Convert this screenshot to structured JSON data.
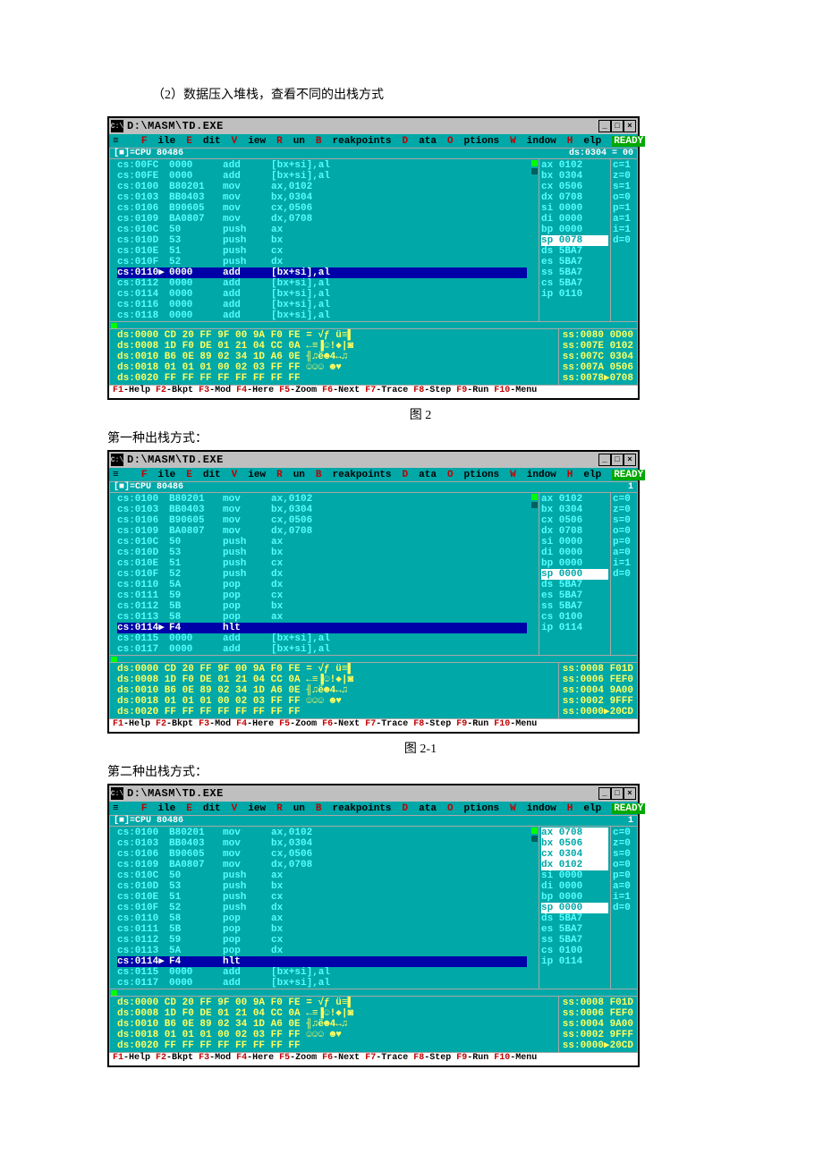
{
  "caption_top": "（2）数据压入堆栈，查看不同的出栈方式",
  "caption_fig2": "图 2",
  "caption_fig21": "图 2-1",
  "subcap1": "第一种出栈方式：",
  "subcap2": "第二种出栈方式：",
  "titlebar_title": "D:\\MASM\\TD.EXE",
  "titlebar_icon": "C:\\",
  "menu": {
    "file": "File",
    "edit": "Edit",
    "view": "View",
    "run": "Run",
    "breakpoints": "Breakpoints",
    "data": "Data",
    "options": "Options",
    "window": "Window",
    "help": "Help",
    "ready": "READY",
    "marker": "≡"
  },
  "btn_min": "_",
  "btn_max": "□",
  "btn_close": "×",
  "wintitle_left": "[■]=CPU 80486",
  "d1": {
    "wintitle_right": "ds:0304 = 00",
    "code": [
      {
        "a": "cs:00FC",
        "b": "0000",
        "m": "add",
        "o": "[bx+si],al"
      },
      {
        "a": "cs:00FE",
        "b": "0000",
        "m": "add",
        "o": "[bx+si],al"
      },
      {
        "a": "cs:0100",
        "b": "B80201",
        "m": "mov",
        "o": "ax,0102"
      },
      {
        "a": "cs:0103",
        "b": "BB0403",
        "m": "mov",
        "o": "bx,0304"
      },
      {
        "a": "cs:0106",
        "b": "B90605",
        "m": "mov",
        "o": "cx,0506"
      },
      {
        "a": "cs:0109",
        "b": "BA0807",
        "m": "mov",
        "o": "dx,0708"
      },
      {
        "a": "cs:010C",
        "b": "50",
        "m": "push",
        "o": "ax"
      },
      {
        "a": "cs:010D",
        "b": "53",
        "m": "push",
        "o": "bx"
      },
      {
        "a": "cs:010E",
        "b": "51",
        "m": "push",
        "o": "cx"
      },
      {
        "a": "cs:010F",
        "b": "52",
        "m": "push",
        "o": "dx"
      },
      {
        "a": "cs:0110▶",
        "b": "0000",
        "m": "add",
        "o": "[bx+si],al",
        "cur": true
      },
      {
        "a": "cs:0112",
        "b": "0000",
        "m": "add",
        "o": "[bx+si],al"
      },
      {
        "a": "cs:0114",
        "b": "0000",
        "m": "add",
        "o": "[bx+si],al"
      },
      {
        "a": "cs:0116",
        "b": "0000",
        "m": "add",
        "o": "[bx+si],al"
      },
      {
        "a": "cs:0118",
        "b": "0000",
        "m": "add",
        "o": "[bx+si],al"
      }
    ],
    "regs": [
      {
        "n": "ax",
        "v": "0102"
      },
      {
        "n": "bx",
        "v": "0304"
      },
      {
        "n": "cx",
        "v": "0506"
      },
      {
        "n": "dx",
        "v": "0708"
      },
      {
        "n": "si",
        "v": "0000"
      },
      {
        "n": "di",
        "v": "0000"
      },
      {
        "n": "bp",
        "v": "0000"
      },
      {
        "n": "sp",
        "v": "0078",
        "hl": true
      },
      {
        "n": "ds",
        "v": "5BA7"
      },
      {
        "n": "es",
        "v": "5BA7"
      },
      {
        "n": "ss",
        "v": "5BA7"
      },
      {
        "n": "cs",
        "v": "5BA7"
      },
      {
        "n": "ip",
        "v": "0110"
      }
    ],
    "flags": [
      "c=1",
      "z=0",
      "s=1",
      "o=0",
      "p=1",
      "a=1",
      "i=1",
      "d=0"
    ],
    "dump": [
      "ds:0000 CD 20 FF 9F 00 9A F0 FE = √ƒ ü≡▌",
      "ds:0008 1D F0 DE 01 21 04 CC 0A ←≡▐☺!◆|◙",
      "ds:0010 B6 0E 89 02 34 1D A6 0E ╢♫ë☻4↔♫",
      "ds:0018 01 01 01 00 02 03 FF FF ☺☺☺ ☻♥  ",
      "ds:0020 FF FF FF FF FF FF FF FF         "
    ],
    "stack": [
      "ss:0080 0D00",
      "ss:007E 0102",
      "ss:007C 0304",
      "ss:007A 0506",
      "ss:0078▶0708"
    ]
  },
  "d2": {
    "code": [
      {
        "a": "cs:0100",
        "b": "B80201",
        "m": "mov",
        "o": "ax,0102"
      },
      {
        "a": "cs:0103",
        "b": "BB0403",
        "m": "mov",
        "o": "bx,0304"
      },
      {
        "a": "cs:0106",
        "b": "B90605",
        "m": "mov",
        "o": "cx,0506"
      },
      {
        "a": "cs:0109",
        "b": "BA0807",
        "m": "mov",
        "o": "dx,0708"
      },
      {
        "a": "cs:010C",
        "b": "50",
        "m": "push",
        "o": "ax"
      },
      {
        "a": "cs:010D",
        "b": "53",
        "m": "push",
        "o": "bx"
      },
      {
        "a": "cs:010E",
        "b": "51",
        "m": "push",
        "o": "cx"
      },
      {
        "a": "cs:010F",
        "b": "52",
        "m": "push",
        "o": "dx"
      },
      {
        "a": "cs:0110",
        "b": "5A",
        "m": "pop",
        "o": "dx"
      },
      {
        "a": "cs:0111",
        "b": "59",
        "m": "pop",
        "o": "cx"
      },
      {
        "a": "cs:0112",
        "b": "5B",
        "m": "pop",
        "o": "bx"
      },
      {
        "a": "cs:0113",
        "b": "58",
        "m": "pop",
        "o": "ax"
      },
      {
        "a": "cs:0114▶",
        "b": "F4",
        "m": "hlt",
        "o": "",
        "cur": true
      },
      {
        "a": "cs:0115",
        "b": "0000",
        "m": "add",
        "o": "[bx+si],al"
      },
      {
        "a": "cs:0117",
        "b": "0000",
        "m": "add",
        "o": "[bx+si],al"
      }
    ],
    "regs": [
      {
        "n": "ax",
        "v": "0102"
      },
      {
        "n": "bx",
        "v": "0304"
      },
      {
        "n": "cx",
        "v": "0506"
      },
      {
        "n": "dx",
        "v": "0708"
      },
      {
        "n": "si",
        "v": "0000"
      },
      {
        "n": "di",
        "v": "0000"
      },
      {
        "n": "bp",
        "v": "0000"
      },
      {
        "n": "sp",
        "v": "0000",
        "hl": true
      },
      {
        "n": "ds",
        "v": "5BA7"
      },
      {
        "n": "es",
        "v": "5BA7"
      },
      {
        "n": "ss",
        "v": "5BA7"
      },
      {
        "n": "cs",
        "v": "0100"
      },
      {
        "n": "ip",
        "v": "0114"
      }
    ],
    "flags": [
      "c=0",
      "z=0",
      "s=0",
      "o=0",
      "p=0",
      "a=0",
      "i=1",
      "d=0"
    ],
    "dump": [
      "ds:0000 CD 20 FF 9F 00 9A F0 FE = √ƒ ü≡▌",
      "ds:0008 1D F0 DE 01 21 04 CC 0A ←≡▐☺!◆|◙",
      "ds:0010 B6 0E 89 02 34 1D A6 0E ╢♫ë☻4↔♫",
      "ds:0018 01 01 01 00 02 03 FF FF ☺☺☺ ☻♥  ",
      "ds:0020 FF FF FF FF FF FF FF FF         "
    ],
    "stack": [
      "ss:0008 F01D",
      "ss:0006 FEF0",
      "ss:0004 9A00",
      "ss:0002 9FFF",
      "ss:0000▶20CD"
    ]
  },
  "d3": {
    "code": [
      {
        "a": "cs:0100",
        "b": "B80201",
        "m": "mov",
        "o": "ax,0102"
      },
      {
        "a": "cs:0103",
        "b": "BB0403",
        "m": "mov",
        "o": "bx,0304"
      },
      {
        "a": "cs:0106",
        "b": "B90605",
        "m": "mov",
        "o": "cx,0506"
      },
      {
        "a": "cs:0109",
        "b": "BA0807",
        "m": "mov",
        "o": "dx,0708"
      },
      {
        "a": "cs:010C",
        "b": "50",
        "m": "push",
        "o": "ax"
      },
      {
        "a": "cs:010D",
        "b": "53",
        "m": "push",
        "o": "bx"
      },
      {
        "a": "cs:010E",
        "b": "51",
        "m": "push",
        "o": "cx"
      },
      {
        "a": "cs:010F",
        "b": "52",
        "m": "push",
        "o": "dx"
      },
      {
        "a": "cs:0110",
        "b": "58",
        "m": "pop",
        "o": "ax"
      },
      {
        "a": "cs:0111",
        "b": "5B",
        "m": "pop",
        "o": "bx"
      },
      {
        "a": "cs:0112",
        "b": "59",
        "m": "pop",
        "o": "cx"
      },
      {
        "a": "cs:0113",
        "b": "5A",
        "m": "pop",
        "o": "dx"
      },
      {
        "a": "cs:0114▶",
        "b": "F4",
        "m": "hlt",
        "o": "",
        "cur": true
      },
      {
        "a": "cs:0115",
        "b": "0000",
        "m": "add",
        "o": "[bx+si],al"
      },
      {
        "a": "cs:0117",
        "b": "0000",
        "m": "add",
        "o": "[bx+si],al"
      }
    ],
    "regs": [
      {
        "n": "ax",
        "v": "0708",
        "hl": true
      },
      {
        "n": "bx",
        "v": "0506",
        "hl": true
      },
      {
        "n": "cx",
        "v": "0304",
        "hl": true
      },
      {
        "n": "dx",
        "v": "0102",
        "hl": true
      },
      {
        "n": "si",
        "v": "0000"
      },
      {
        "n": "di",
        "v": "0000"
      },
      {
        "n": "bp",
        "v": "0000"
      },
      {
        "n": "sp",
        "v": "0000",
        "hl": true
      },
      {
        "n": "ds",
        "v": "5BA7"
      },
      {
        "n": "es",
        "v": "5BA7"
      },
      {
        "n": "ss",
        "v": "5BA7"
      },
      {
        "n": "cs",
        "v": "0100"
      },
      {
        "n": "ip",
        "v": "0114"
      }
    ],
    "flags": [
      "c=0",
      "z=0",
      "s=0",
      "o=0",
      "p=0",
      "a=0",
      "i=1",
      "d=0"
    ],
    "dump": [
      "ds:0000 CD 20 FF 9F 00 9A F0 FE = √ƒ ü≡▌",
      "ds:0008 1D F0 DE 01 21 04 CC 0A ←≡▐☺!◆|◙",
      "ds:0010 B6 0E 89 02 34 1D A6 0E ╢♫ë☻4↔♫",
      "ds:0018 01 01 01 00 02 03 FF FF ☺☺☺ ☻♥  ",
      "ds:0020 FF FF FF FF FF FF FF FF         "
    ],
    "stack": [
      "ss:0008 F01D",
      "ss:0006 FEF0",
      "ss:0004 9A00",
      "ss:0002 9FFF",
      "ss:0000▶20CD"
    ]
  },
  "keyline": {
    "f1": "Help",
    "f2": "Bkpt",
    "f3": "Mod",
    "f4": "Here",
    "f5": "Zoom",
    "f6": "Next",
    "f7": "Trace",
    "f8": "Step",
    "f9": "Run",
    "f10": "Menu"
  }
}
